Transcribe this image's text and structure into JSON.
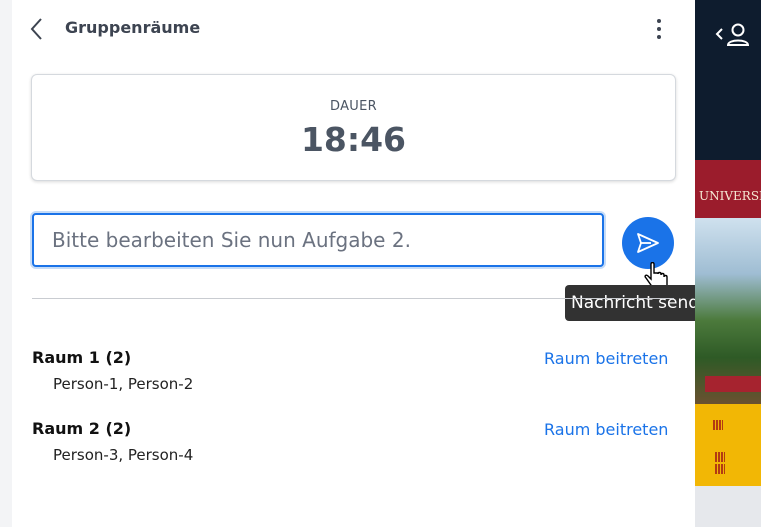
{
  "header": {
    "title": "Gruppenräume",
    "back_icon": "chevron-left-icon",
    "menu_icon": "more-vertical-icon"
  },
  "timer": {
    "label": "DAUER",
    "value": "18:46"
  },
  "message": {
    "value": "Bitte bearbeiten Sie nun Aufgabe 2.",
    "send_icon": "send-icon",
    "tooltip": "Nachricht senden"
  },
  "rooms": [
    {
      "name": "Raum 1 (2)",
      "people": "Person-1, Person-2",
      "join_label": "Raum beitreten"
    },
    {
      "name": "Raum 2 (2)",
      "people": "Person-3, Person-4",
      "join_label": "Raum beitreten"
    }
  ],
  "side": {
    "banner_text": "UNIVERSI",
    "toggle_icon": "user-panel-toggle-icon"
  },
  "colors": {
    "accent": "#1a73e8",
    "text": "#3d4451",
    "side_dark": "#0e1c2e",
    "side_red": "#9b1c2c",
    "side_yellow": "#f2b705"
  }
}
